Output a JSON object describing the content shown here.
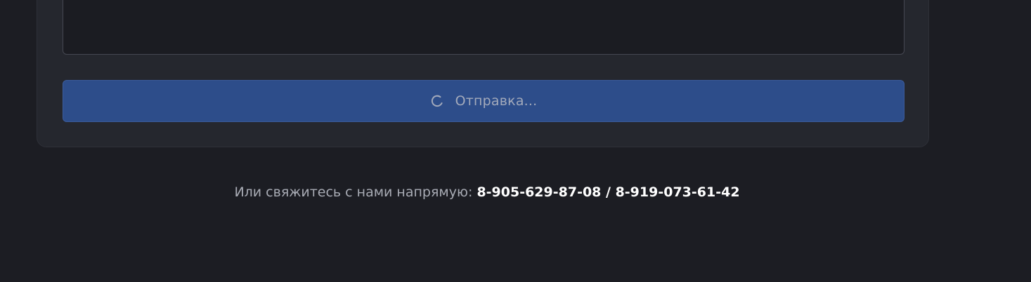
{
  "form": {
    "message_value": "",
    "submit_label": "Отправка...",
    "submit_icon": "spinner-icon"
  },
  "contact": {
    "label": "Или свяжитесь с нами напрямую:",
    "phones": "8-905-629-87-08 / 8-919-073-61-42"
  },
  "colors": {
    "page_background": "#1c1d23",
    "card_background": "#25272e",
    "button_background": "#2d4d8a",
    "button_text": "#a3aabb"
  }
}
